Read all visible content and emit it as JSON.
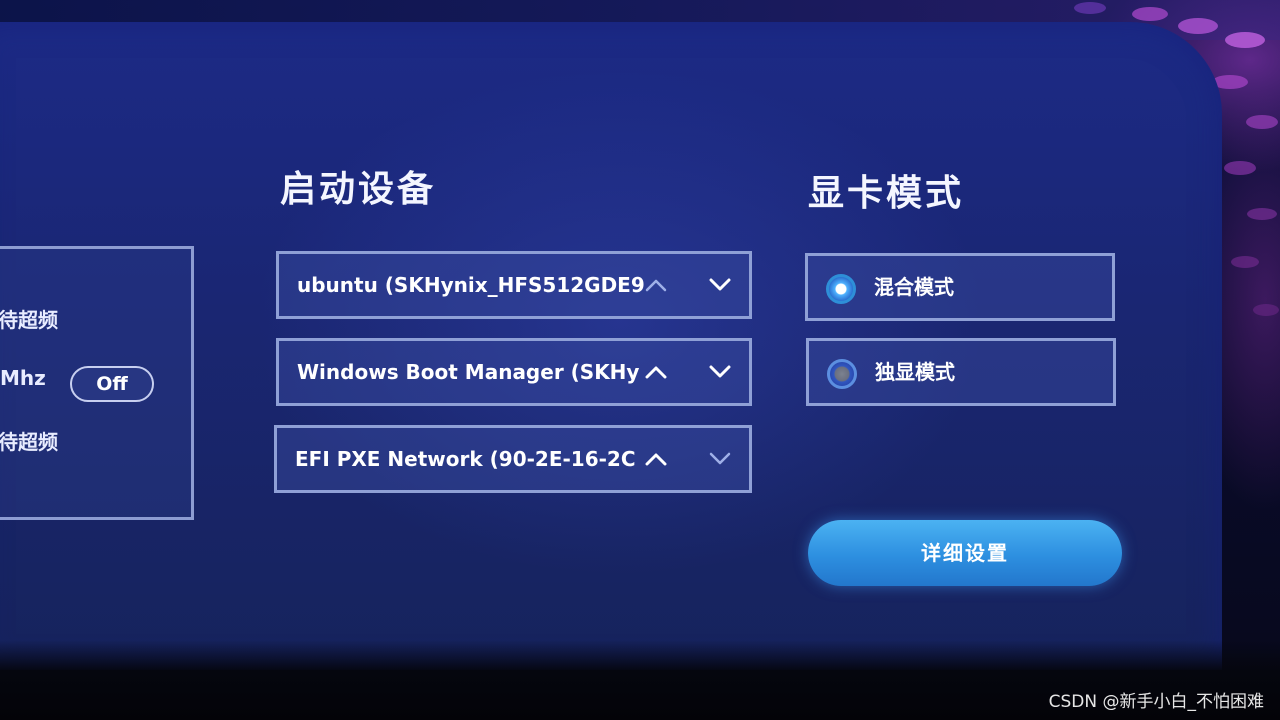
{
  "left_panel": {
    "line1": "待超频",
    "mhz_label": "Mhz",
    "toggle": "Off",
    "line3": "待超频"
  },
  "boot_devices": {
    "title": "启动设备",
    "items": [
      {
        "label": "ubuntu (SKHynix_HFS512GDE9"
      },
      {
        "label": "Windows Boot Manager (SKHy"
      },
      {
        "label": "EFI PXE Network (90-2E-16-2C"
      }
    ]
  },
  "gpu_mode": {
    "title": "显卡模式",
    "options": [
      {
        "label": "混合模式",
        "selected": true
      },
      {
        "label": "独显模式",
        "selected": false
      }
    ],
    "detail_button": "详细设置"
  },
  "watermark": "CSDN @新手小白_不怕困难",
  "colors": {
    "background": "#1a2672",
    "border": "#8fa0d6",
    "accent": "#2d8fe0",
    "text": "#ffffff"
  },
  "icons": [
    "chevron-up-icon",
    "chevron-down-icon",
    "radio-selected-icon",
    "radio-unselected-icon"
  ]
}
